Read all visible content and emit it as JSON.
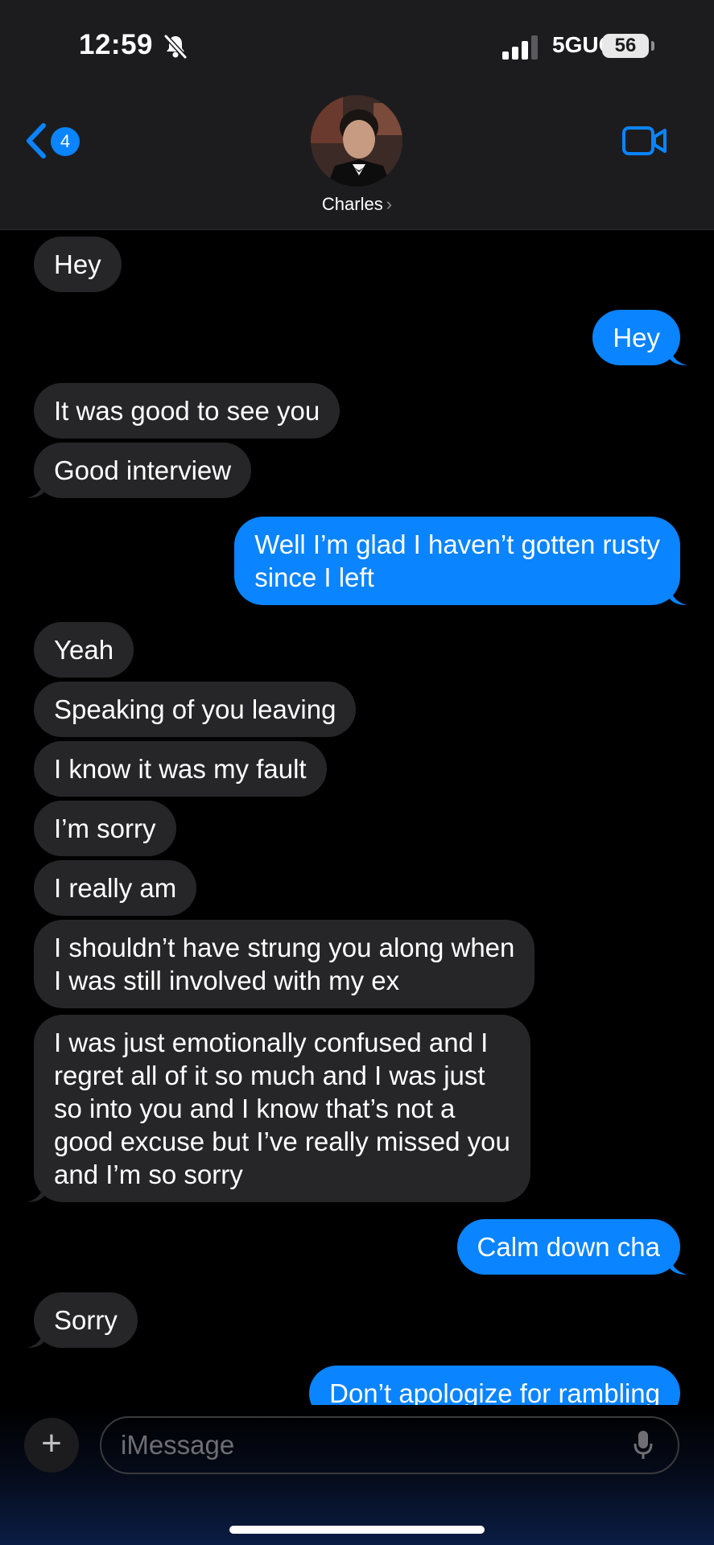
{
  "status_bar": {
    "time": "12:59",
    "network": "5GUC",
    "battery": "56",
    "icons": [
      "bell-slash-icon",
      "signal-icon",
      "battery-icon"
    ]
  },
  "header": {
    "back_badge": "4",
    "contact_name": "Charles",
    "icons": [
      "back-chevron-icon",
      "video-call-icon",
      "contact-chevron-icon"
    ]
  },
  "messages": [
    {
      "from": "them",
      "lines": [
        "Hey"
      ]
    },
    {
      "from": "me",
      "lines": [
        "Hey"
      ]
    },
    {
      "from": "them",
      "lines": [
        "It was good to see you"
      ]
    },
    {
      "from": "them",
      "lines": [
        "Good interview"
      ]
    },
    {
      "from": "me",
      "lines": [
        "Well I’m glad I haven’t gotten rusty",
        "since I left"
      ]
    },
    {
      "from": "them",
      "lines": [
        "Yeah"
      ]
    },
    {
      "from": "them",
      "lines": [
        "Speaking of you leaving"
      ]
    },
    {
      "from": "them",
      "lines": [
        "I know it was my fault"
      ]
    },
    {
      "from": "them",
      "lines": [
        "I’m sorry"
      ]
    },
    {
      "from": "them",
      "lines": [
        "I really am"
      ]
    },
    {
      "from": "them",
      "lines": [
        "I shouldn’t have strung you along when",
        "I was still involved with my ex"
      ]
    },
    {
      "from": "them",
      "lines": [
        "I was just emotionally confused and I",
        "regret all of it so much and I was just",
        "so into you and I know that’s not a",
        "good excuse but I’ve really missed you",
        "and I’m so sorry"
      ]
    },
    {
      "from": "me",
      "lines": [
        "Calm down cha"
      ]
    },
    {
      "from": "them",
      "lines": [
        "Sorry"
      ]
    },
    {
      "from": "me",
      "lines": [
        "Don’t apologize for rambling"
      ]
    }
  ],
  "composer": {
    "placeholder": "iMessage",
    "icons": [
      "plus-icon",
      "microphone-icon"
    ]
  },
  "colors": {
    "sent_bubble": "#0a84ff",
    "received_bubble": "#262628",
    "background": "#000000",
    "header_background": "#1c1c1e"
  }
}
